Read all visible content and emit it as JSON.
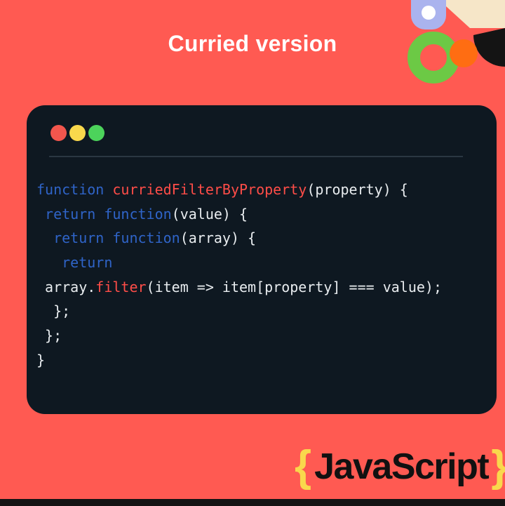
{
  "title": "Curried version",
  "code": {
    "lines": [
      [
        {
          "t": "function ",
          "c": "kw"
        },
        {
          "t": "curriedFilterByProperty",
          "c": "fn"
        },
        {
          "t": "(property) {",
          "c": "plain"
        }
      ],
      [
        {
          "t": " ",
          "c": "plain"
        },
        {
          "t": "return function",
          "c": "kw"
        },
        {
          "t": "(value) {",
          "c": "plain"
        }
      ],
      [
        {
          "t": "  ",
          "c": "plain"
        },
        {
          "t": "return function",
          "c": "kw"
        },
        {
          "t": "(array) {",
          "c": "plain"
        }
      ],
      [
        {
          "t": "   ",
          "c": "plain"
        },
        {
          "t": "return",
          "c": "kw"
        }
      ],
      [
        {
          "t": " array.",
          "c": "plain"
        },
        {
          "t": "filter",
          "c": "fn"
        },
        {
          "t": "(item => item[property] === value);",
          "c": "plain"
        }
      ],
      [
        {
          "t": "  };",
          "c": "plain"
        }
      ],
      [
        {
          "t": " };",
          "c": "plain"
        }
      ],
      [
        {
          "t": "}",
          "c": "plain"
        }
      ]
    ]
  },
  "brand": {
    "open_brace": "{",
    "word": "JavaScript",
    "close_brace": "}"
  },
  "colors": {
    "background": "#ff5a52",
    "card": "#0e1821",
    "keyword": "#2f64c8",
    "function_name": "#ff4d48",
    "brace": "#f9d84c"
  }
}
